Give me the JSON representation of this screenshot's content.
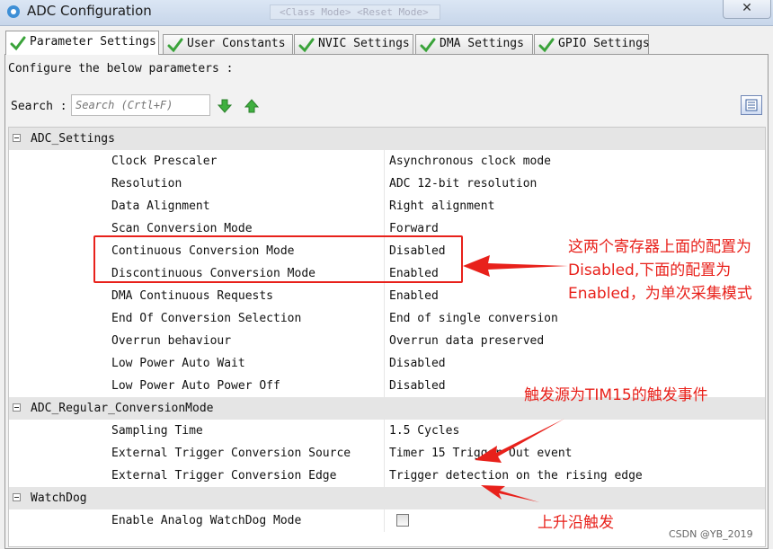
{
  "window": {
    "title": "ADC Configuration",
    "close_label": "✕",
    "background_hint": "<Class Mode> <Reset Mode>"
  },
  "tabs": [
    {
      "label": "Parameter Settings",
      "active": true
    },
    {
      "label": "User Constants",
      "active": false
    },
    {
      "label": "NVIC Settings",
      "active": false
    },
    {
      "label": "DMA Settings",
      "active": false
    },
    {
      "label": "GPIO Settings",
      "active": false
    }
  ],
  "configure_label": "Configure the below parameters :",
  "search": {
    "label": "Search",
    "placeholder": "Search (Crtl+F)"
  },
  "groups": [
    {
      "name": "ADC_Settings",
      "params": [
        {
          "name": "Clock Prescaler",
          "value": "Asynchronous clock mode"
        },
        {
          "name": "Resolution",
          "value": "ADC 12-bit resolution"
        },
        {
          "name": "Data Alignment",
          "value": "Right alignment"
        },
        {
          "name": "Scan Conversion Mode",
          "value": "Forward"
        },
        {
          "name": "Continuous Conversion Mode",
          "value": "Disabled"
        },
        {
          "name": "Discontinuous Conversion Mode",
          "value": "Enabled"
        },
        {
          "name": "DMA Continuous Requests",
          "value": "Enabled"
        },
        {
          "name": "End Of Conversion Selection",
          "value": "End of single conversion"
        },
        {
          "name": "Overrun behaviour",
          "value": "Overrun data preserved"
        },
        {
          "name": "Low Power Auto Wait",
          "value": "Disabled"
        },
        {
          "name": "Low Power Auto Power Off",
          "value": "Disabled"
        }
      ]
    },
    {
      "name": "ADC_Regular_ConversionMode",
      "params": [
        {
          "name": "Sampling Time",
          "value": "1.5 Cycles"
        },
        {
          "name": "External Trigger Conversion Source",
          "value": "Timer 15 Trigger Out event"
        },
        {
          "name": "External Trigger Conversion Edge",
          "value": "Trigger detection on the rising edge"
        }
      ]
    },
    {
      "name": "WatchDog",
      "params": [
        {
          "name": "Enable Analog WatchDog Mode",
          "value": "",
          "checkbox": true,
          "checked": false
        }
      ]
    }
  ],
  "annotations": {
    "note1": "这两个寄存器上面的配置为Disabled,下面的配置为Enabled，为单次采集模式",
    "note2": "触发源为TIM15的触发事件",
    "note3": "上升沿触发",
    "color": "#e8211b"
  },
  "watermark": "CSDN @YB_2019"
}
